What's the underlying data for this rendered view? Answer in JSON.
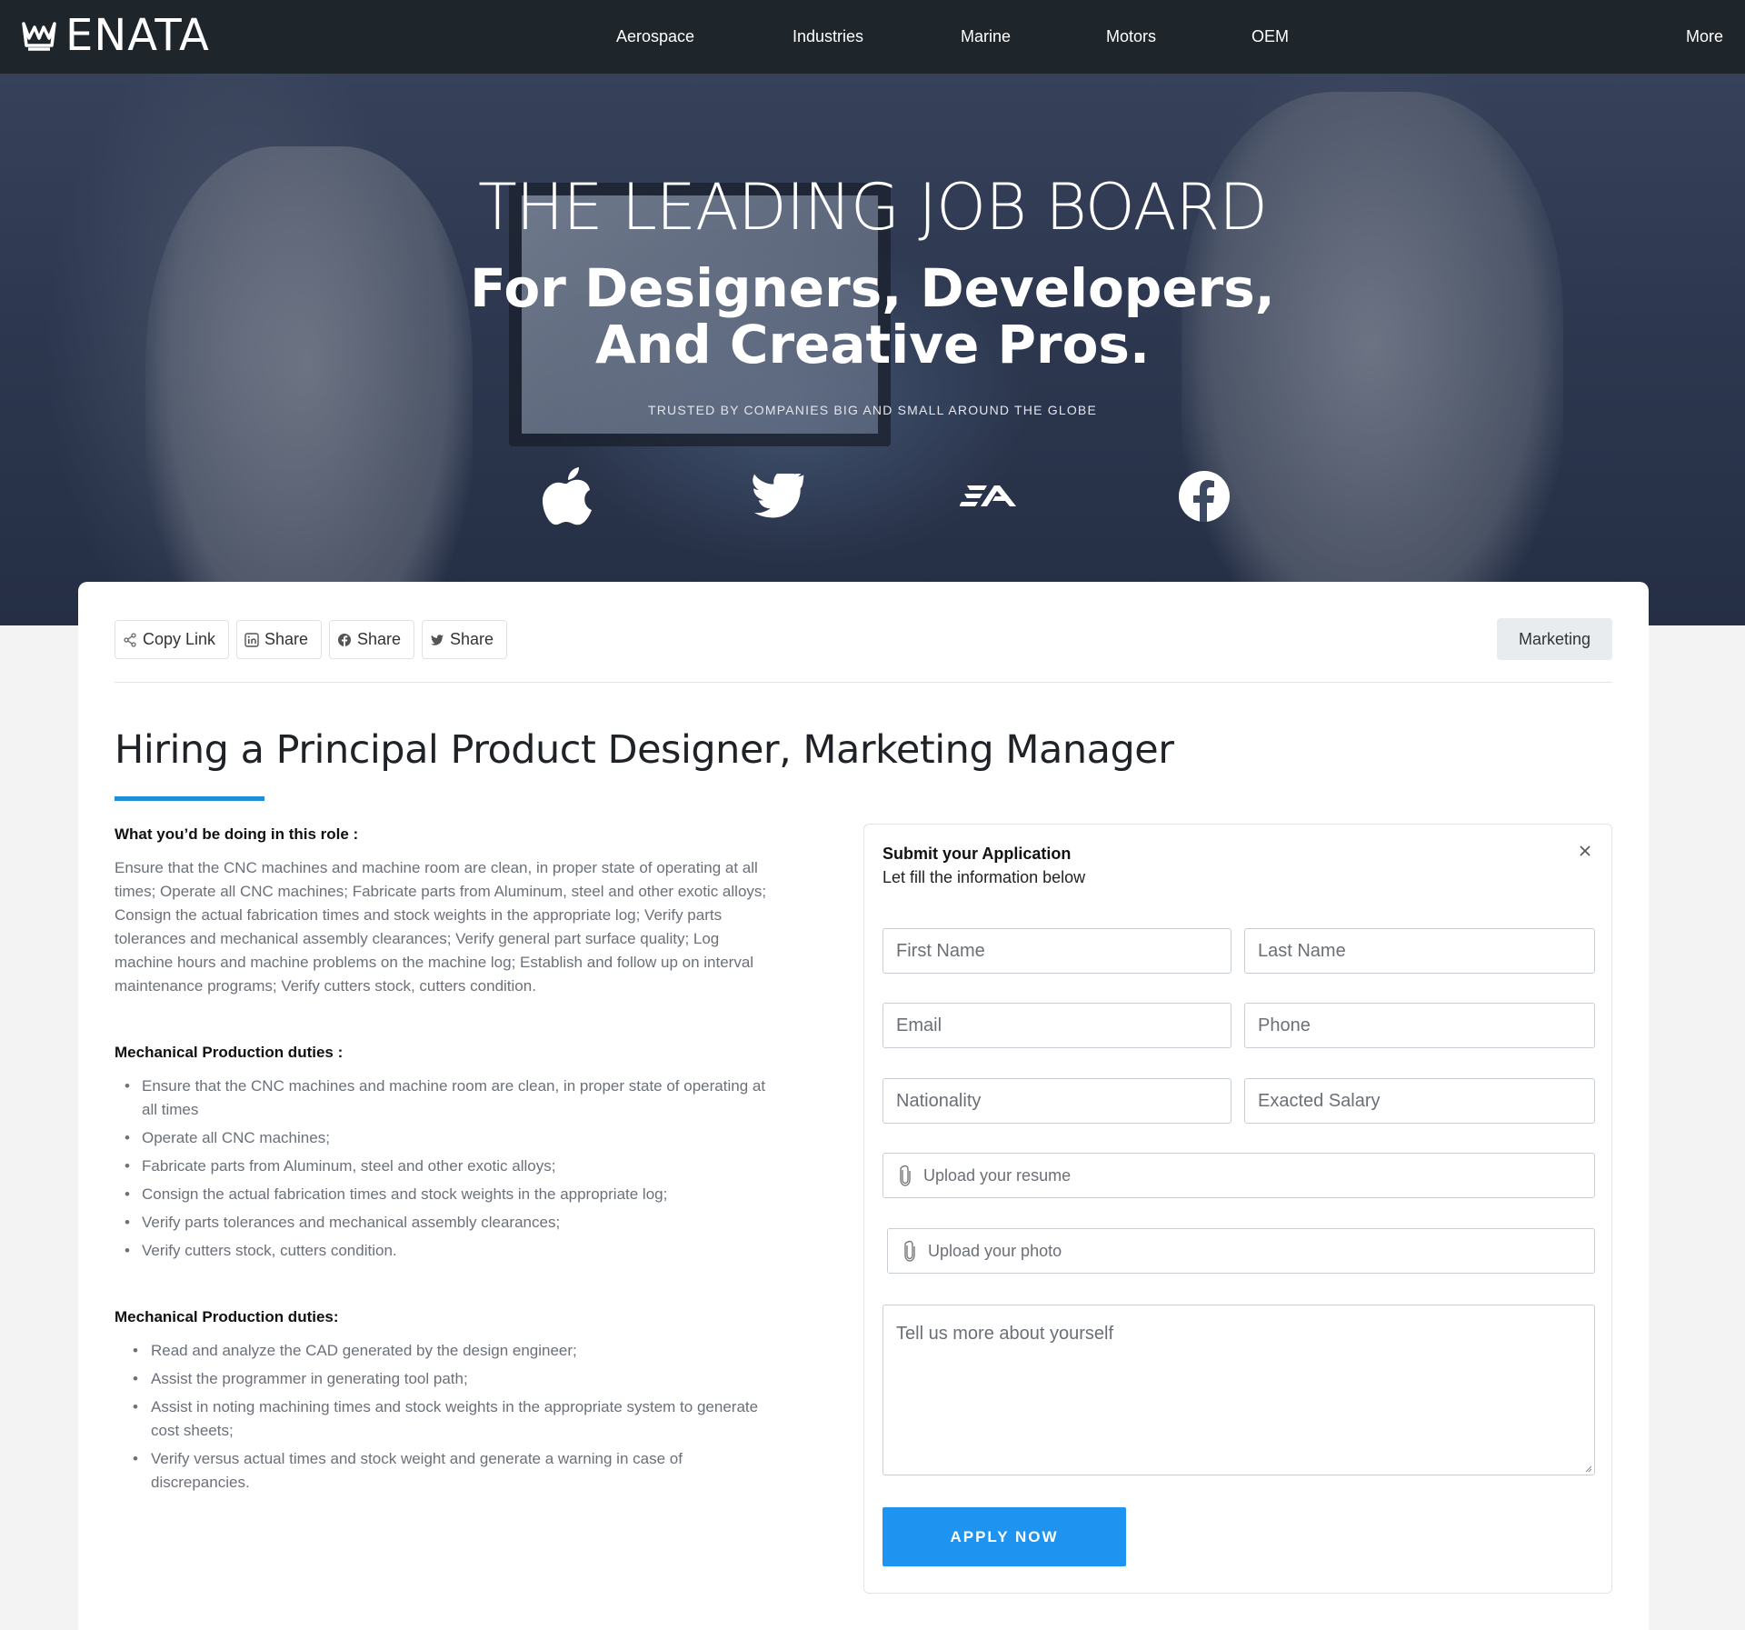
{
  "nav": {
    "logo_text": "ENATA",
    "items": [
      "Aerospace",
      "Industries",
      "Marine",
      "Motors",
      "OEM"
    ],
    "more": "More"
  },
  "hero": {
    "kicker": "THE LEADING JOB BOARD",
    "title_line1": "For Designers, Developers,",
    "title_line2": "And Creative Pros.",
    "subtitle": "TRUSTED BY COMPANIES BIG AND SMALL AROUND THE GLOBE",
    "brands": [
      "apple-icon",
      "twitter-icon",
      "ea-icon",
      "facebook-icon"
    ]
  },
  "share": {
    "copy_link": "Copy Link",
    "linkedin": "Share",
    "facebook": "Share",
    "twitter": "Share"
  },
  "tag": "Marketing",
  "job": {
    "title": "Hiring a Principal Product Designer, Marketing Manager",
    "section1_heading": "What you’d be doing in this role :",
    "section1_text": "Ensure that the CNC machines and machine room are clean, in proper state of operating at all times; Operate all CNC machines; Fabricate parts from Aluminum, steel and other exotic alloys; Consign the actual fabrication times and stock weights in the appropriate log; Verify parts tolerances and mechanical assembly clearances; Verify general part surface quality; Log machine hours and machine problems on the machine log; Establish and follow up on interval maintenance programs; Verify cutters stock, cutters condition.",
    "section2_heading": "Mechanical Production duties :",
    "section2_items": [
      "Ensure that the CNC machines and machine room are clean, in proper state of operating at all times",
      "Operate all CNC machines;",
      "Fabricate parts from Aluminum, steel and other exotic alloys;",
      "Consign the actual fabrication times and stock weights in the appropriate log;",
      "Verify parts tolerances and mechanical assembly clearances;",
      "Verify cutters stock, cutters condition."
    ],
    "section3_heading": "Mechanical Production duties:",
    "section3_items": [
      "Read and analyze the CAD generated by the design engineer;",
      "Assist the programmer in generating tool path;",
      "Assist in noting machining times and stock weights in the appropriate system to generate cost sheets;",
      "Verify versus actual times and stock weight and generate a warning in case of discrepancies."
    ]
  },
  "form": {
    "title": "Submit your Application",
    "subtitle": "Let fill the information below",
    "first_name": "First Name",
    "last_name": "Last Name",
    "email": "Email",
    "phone": "Phone",
    "nationality": "Nationality",
    "salary": "Exacted Salary",
    "resume": "Upload your resume",
    "photo": "Upload your photo",
    "about": "Tell us more about yourself",
    "submit": "APPLY NOW"
  }
}
